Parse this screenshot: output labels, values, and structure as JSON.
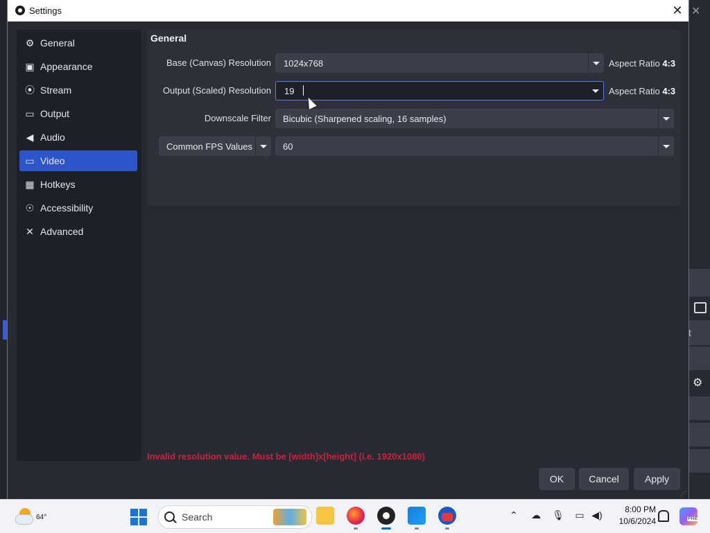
{
  "dialog": {
    "title": "Settings",
    "close_icon": "close-icon"
  },
  "sidebar": {
    "items": [
      {
        "label": "General",
        "icon": "gear-icon"
      },
      {
        "label": "Appearance",
        "icon": "palette-icon"
      },
      {
        "label": "Stream",
        "icon": "antenna-icon"
      },
      {
        "label": "Output",
        "icon": "output-icon"
      },
      {
        "label": "Audio",
        "icon": "speaker-icon"
      },
      {
        "label": "Video",
        "icon": "monitor-icon",
        "active": true
      },
      {
        "label": "Hotkeys",
        "icon": "keyboard-icon"
      },
      {
        "label": "Accessibility",
        "icon": "accessibility-icon"
      },
      {
        "label": "Advanced",
        "icon": "tools-icon"
      }
    ]
  },
  "video": {
    "group_title": "General",
    "base_label": "Base (Canvas) Resolution",
    "base_value": "1024x768",
    "base_aspect_label": "Aspect Ratio",
    "base_aspect_value": "4:3",
    "output_label": "Output (Scaled) Resolution",
    "output_value": "19",
    "output_aspect_label": "Aspect Ratio",
    "output_aspect_value": "4:3",
    "downscale_label": "Downscale Filter",
    "downscale_value": "Bicubic (Sharpened scaling, 16 samples)",
    "fps_type": "Common FPS Values",
    "fps_value": "60"
  },
  "error_message": "Invalid resolution value. Must be [width]x[height] (i.e. 1920x1080)",
  "buttons": {
    "ok": "OK",
    "cancel": "Cancel",
    "apply": "Apply"
  },
  "taskbar": {
    "weather_temp": "64°",
    "search_placeholder": "Search",
    "time": "8:00 PM",
    "date": "10/6/2024",
    "copilot_badge": "PRE"
  },
  "colors": {
    "accent": "#2b55c8",
    "error": "#d11f3b",
    "panel": "#2d3039"
  }
}
